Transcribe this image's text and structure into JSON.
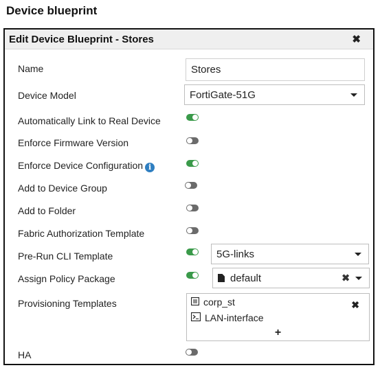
{
  "page": {
    "heading": "Device blueprint"
  },
  "dialog": {
    "title": "Edit Device Blueprint - Stores",
    "close_glyph": "✖"
  },
  "fields": {
    "name": {
      "label": "Name",
      "value": "Stores"
    },
    "device_model": {
      "label": "Device Model",
      "value": "FortiGate-51G"
    },
    "auto_link": {
      "label": "Automatically Link to Real Device",
      "enabled": true
    },
    "enforce_firmware": {
      "label": "Enforce Firmware Version",
      "enabled": false
    },
    "enforce_config": {
      "label": "Enforce Device Configuration",
      "info_glyph": "i",
      "enabled": true
    },
    "add_group": {
      "label": "Add to Device Group",
      "enabled": false
    },
    "add_folder": {
      "label": "Add to Folder",
      "enabled": false
    },
    "fabric_auth": {
      "label": "Fabric Authorization Template",
      "enabled": false
    },
    "pre_run_cli": {
      "label": "Pre-Run CLI Template",
      "enabled": true,
      "value": "5G-links"
    },
    "policy_package": {
      "label": "Assign Policy Package",
      "enabled": true,
      "value": "default",
      "clear_glyph": "✖"
    },
    "provisioning": {
      "label": "Provisioning Templates",
      "items": [
        {
          "name": "corp_st",
          "icon": "template-icon"
        },
        {
          "name": "LAN-interface",
          "icon": "cli-script-icon"
        }
      ],
      "remove_glyph": "✖",
      "add_glyph": "+"
    },
    "ha": {
      "label": "HA",
      "enabled": false
    }
  },
  "colors": {
    "toggle_on": "#3a9a4a",
    "toggle_off": "#6b6b6b",
    "info": "#2f7fc1"
  }
}
